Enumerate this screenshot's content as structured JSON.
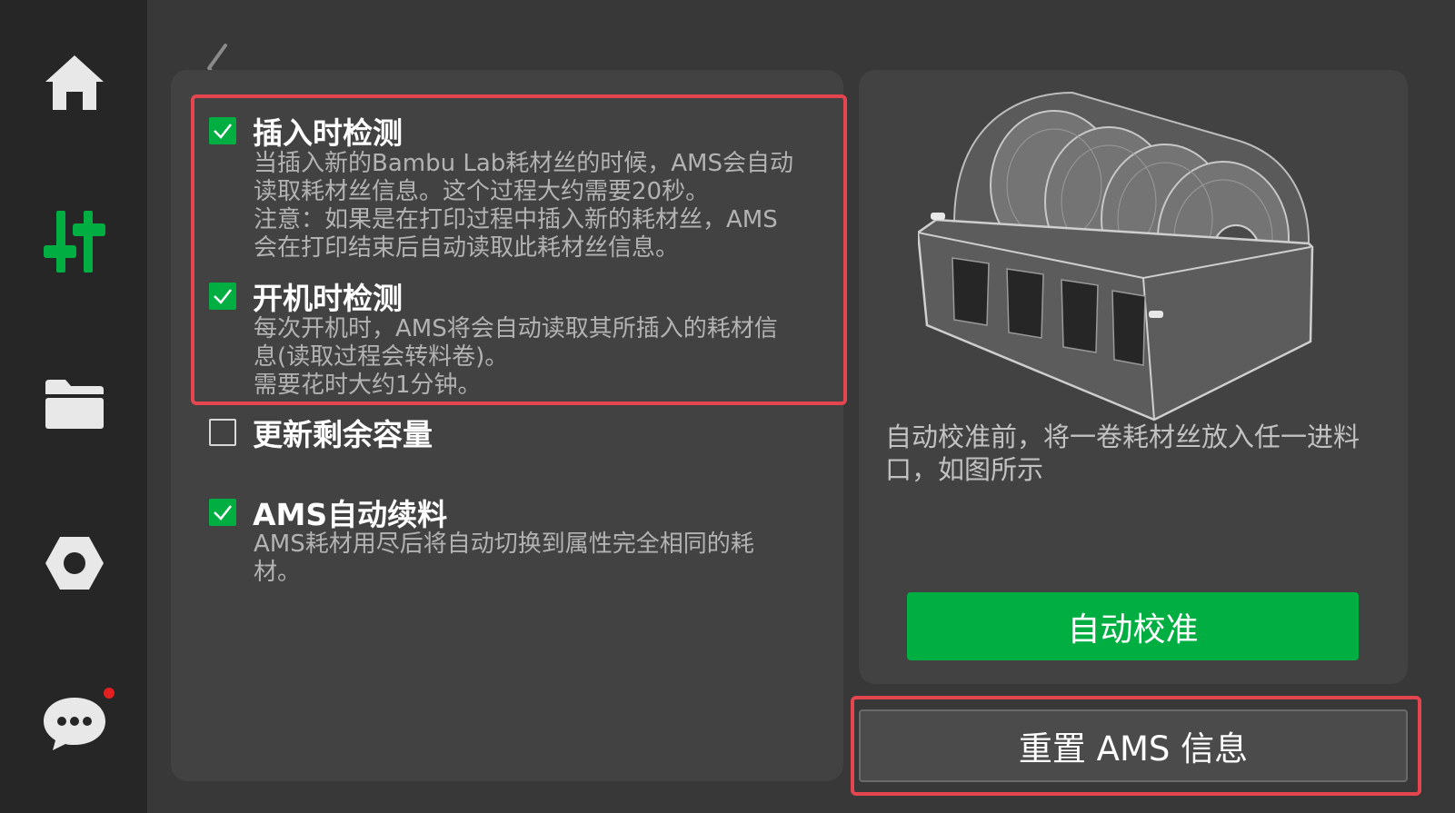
{
  "colors": {
    "accent": "#00ae42",
    "highlight": "#e5454f",
    "background": "#383838",
    "panel": "#424242",
    "sidebar": "#262626"
  },
  "sidebar": {
    "items": [
      {
        "icon": "home-icon"
      },
      {
        "icon": "control-sliders-icon",
        "active": true
      },
      {
        "icon": "folder-icon"
      },
      {
        "icon": "settings-hexagon-icon"
      },
      {
        "icon": "message-icon",
        "notification": true
      }
    ]
  },
  "options": [
    {
      "title": "插入时检测",
      "checked": true,
      "desc": [
        "当插入新的Bambu Lab耗材丝的时候，AMS会自动",
        "读取耗材丝信息。这个过程大约需要20秒。",
        "注意：如果是在打印过程中插入新的耗材丝，AMS",
        "会在打印结束后自动读取此耗材丝信息。"
      ]
    },
    {
      "title": "开机时检测",
      "checked": true,
      "desc": [
        "每次开机时，AMS将会自动读取其所插入的耗材信",
        "息(读取过程会转料卷)。",
        "需要花时大约1分钟。"
      ]
    },
    {
      "title": "更新剩余容量",
      "checked": false,
      "desc": []
    },
    {
      "title": "AMS自动续料",
      "checked": true,
      "desc": [
        "AMS耗材用尽后将自动切换到属性完全相同的耗",
        "材。"
      ]
    }
  ],
  "calibration": {
    "hint": [
      "自动校准前，将一卷耗材丝放入任一进料",
      "口，如图所示"
    ],
    "button_label": "自动校准"
  },
  "reset_button_label": "重置 AMS 信息"
}
